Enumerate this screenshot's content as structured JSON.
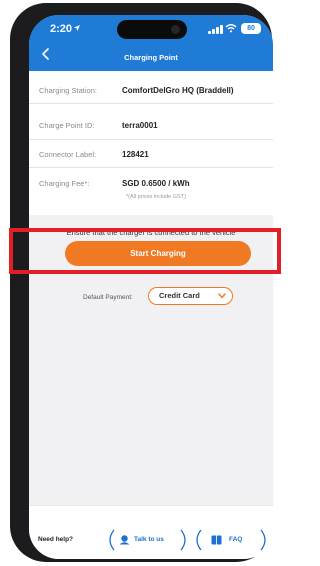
{
  "status_bar": {
    "time": "2:20",
    "battery": "80"
  },
  "header": {
    "title": "Charging Point"
  },
  "details": [
    {
      "label": "Charging Station:",
      "value": "ComfortDelGro HQ (Braddell)"
    },
    {
      "label": "Charge Point ID:",
      "value": "terra0001"
    },
    {
      "label": "Connector Label:",
      "value": "128421"
    },
    {
      "label": "Charging Fee*:",
      "value": "SGD 0.6500 / kWh"
    }
  ],
  "fee_note": "*(All prices include GST)",
  "instruction": "Ensure that the charger is connected to the vehicle",
  "start_button_label": "Start Charging",
  "payment": {
    "label": "Default Payment:",
    "selected": "Credit Card"
  },
  "footer": {
    "help_label": "Need help?",
    "talk_label": "Talk to us",
    "faq_label": "FAQ"
  },
  "colors": {
    "header": "#1f7bd6",
    "accent": "#f07a23",
    "highlight": "#e21f26",
    "link": "#1f6fd0"
  }
}
